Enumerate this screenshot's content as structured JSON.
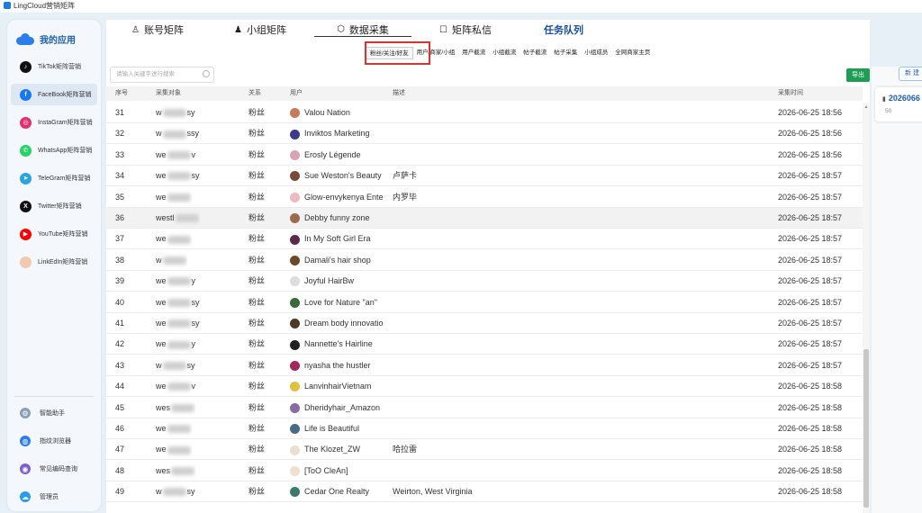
{
  "window": {
    "title": "LingCloud营销矩阵"
  },
  "sidebar": {
    "header": "我的应用",
    "items": [
      {
        "label": "TikTok矩阵营销",
        "icon": "tiktok-icon",
        "color": "#111111",
        "glyph": "♪",
        "active": false
      },
      {
        "label": "FaceBook矩阵营销",
        "icon": "facebook-icon",
        "color": "#1877f2",
        "glyph": "f",
        "active": true
      },
      {
        "label": "InstaGram矩阵营销",
        "icon": "instagram-icon",
        "color": "#e1306c",
        "glyph": "◎",
        "active": false
      },
      {
        "label": "WhatsApp矩阵营销",
        "icon": "whatsapp-icon",
        "color": "#25d366",
        "glyph": "✆",
        "active": false
      },
      {
        "label": "TeleGram矩阵营销",
        "icon": "telegram-icon",
        "color": "#2aa3df",
        "glyph": "➤",
        "active": false
      },
      {
        "label": "Twitter矩阵营销",
        "icon": "twitter-x-icon",
        "color": "#111111",
        "glyph": "X",
        "active": false
      },
      {
        "label": "YouTube矩阵营销",
        "icon": "youtube-icon",
        "color": "#ff0000",
        "glyph": "▶",
        "active": false
      },
      {
        "label": "LinkEdIn矩阵营销",
        "icon": "linkedin-icon",
        "color": "#f0c9b0",
        "glyph": "",
        "active": false
      }
    ],
    "tools": [
      {
        "label": "智能助手",
        "icon": "gear-icon",
        "color": "#8aa0b8",
        "glyph": "⚙"
      },
      {
        "label": "指纹浏览器",
        "icon": "globe-icon",
        "color": "#2b7de9",
        "glyph": "◍"
      },
      {
        "label": "常见编码查询",
        "icon": "code-query-icon",
        "color": "#7b5fd1",
        "glyph": "◉"
      },
      {
        "label": "管理员",
        "icon": "admin-cloud-icon",
        "color": "#2b9be9",
        "glyph": "☁"
      }
    ]
  },
  "tabs": [
    {
      "label": "账号矩阵",
      "icon": "person-icon",
      "glyph": "♙",
      "active": false,
      "bold": false
    },
    {
      "label": "小组矩阵",
      "icon": "group-icon",
      "glyph": "♟",
      "active": false,
      "bold": false
    },
    {
      "label": "数据采集",
      "icon": "cube-icon",
      "glyph": "⬡",
      "active": true,
      "bold": false
    },
    {
      "label": "矩阵私信",
      "icon": "message-icon",
      "glyph": "☐",
      "active": false,
      "bold": false
    },
    {
      "label": "任务队列",
      "icon": "",
      "glyph": "",
      "active": false,
      "bold": true
    }
  ],
  "subtabs": [
    {
      "label": "粉丝/关注/好友",
      "active": true
    },
    {
      "label": "用户/商家/小组",
      "active": false
    },
    {
      "label": "用户截流",
      "active": false
    },
    {
      "label": "小组截流",
      "active": false
    },
    {
      "label": "帖子截流",
      "active": false
    },
    {
      "label": "帖子采集",
      "active": false
    },
    {
      "label": "小组成员",
      "active": false
    },
    {
      "label": "全网商家主页",
      "active": false
    }
  ],
  "search": {
    "placeholder": "请输入关键字进行搜索"
  },
  "toolbar": {
    "export_label": "导出"
  },
  "table": {
    "columns": {
      "no": "序号",
      "target": "采集对象",
      "relation": "关系",
      "user": "用户",
      "desc": "描述",
      "time": "采集时间"
    },
    "rows": [
      {
        "no": "31",
        "t1": "w",
        "t2": "sy",
        "rel": "粉丝",
        "user": "Valou Nation",
        "desc": "",
        "time": "2026-06-25 18:56",
        "av": "#c67b5c"
      },
      {
        "no": "32",
        "t1": "w",
        "t2": "ssy",
        "rel": "粉丝",
        "user": "Inviktos Marketing",
        "desc": "",
        "time": "2026-06-25 18:56",
        "av": "#3b3b8c"
      },
      {
        "no": "33",
        "t1": "we",
        "t2": "v",
        "rel": "粉丝",
        "user": "Erosly Légende",
        "desc": "",
        "time": "2026-06-25 18:56",
        "av": "#d9a3b5"
      },
      {
        "no": "34",
        "t1": "we",
        "t2": "sy",
        "rel": "粉丝",
        "user": "Sue Weston's Beauty",
        "desc": "卢萨卡",
        "time": "2026-06-25 18:57",
        "av": "#7a4a3a"
      },
      {
        "no": "35",
        "t1": "we",
        "t2": "",
        "rel": "粉丝",
        "user": "Glow-envykenya Enterprises",
        "desc": "内罗毕",
        "time": "2026-06-25 18:57",
        "av": "#f0b8c0"
      },
      {
        "no": "36",
        "t1": "westl",
        "t2": "",
        "rel": "粉丝",
        "user": "Debby funny zone",
        "desc": "",
        "time": "2026-06-25 18:57",
        "av": "#9c6b4e"
      },
      {
        "no": "37",
        "t1": "we",
        "t2": "",
        "rel": "粉丝",
        "user": "In My Soft Girl Era",
        "desc": "",
        "time": "2026-06-25 18:57",
        "av": "#5a2a4a"
      },
      {
        "no": "38",
        "t1": "w",
        "t2": "",
        "rel": "粉丝",
        "user": "Damali's hair shop",
        "desc": "",
        "time": "2026-06-25 18:57",
        "av": "#6b4a2a"
      },
      {
        "no": "39",
        "t1": "we",
        "t2": "y",
        "rel": "粉丝",
        "user": "Joyful HairBw",
        "desc": "",
        "time": "2026-06-25 18:57",
        "av": "#dddddd"
      },
      {
        "no": "40",
        "t1": "we",
        "t2": "sy",
        "rel": "粉丝",
        "user": "Love for Nature \"an\"",
        "desc": "",
        "time": "2026-06-25 18:57",
        "av": "#3a6a3a"
      },
      {
        "no": "41",
        "t1": "we",
        "t2": "sy",
        "rel": "粉丝",
        "user": "Dream body innovations",
        "desc": "",
        "time": "2026-06-25 18:57",
        "av": "#4a3a2a"
      },
      {
        "no": "42",
        "t1": "we",
        "t2": "y",
        "rel": "粉丝",
        "user": "Nannette's Hairline",
        "desc": "",
        "time": "2026-06-25 18:57",
        "av": "#222222"
      },
      {
        "no": "43",
        "t1": "w",
        "t2": "sy",
        "rel": "粉丝",
        "user": "nyasha the hustler",
        "desc": "",
        "time": "2026-06-25 18:57",
        "av": "#a02a5a"
      },
      {
        "no": "44",
        "t1": "we",
        "t2": "v",
        "rel": "粉丝",
        "user": "LanvinhairVietnam",
        "desc": "",
        "time": "2026-06-25 18:58",
        "av": "#e0c040"
      },
      {
        "no": "45",
        "t1": "wes",
        "t2": "",
        "rel": "粉丝",
        "user": "Dheridyhair_Amazon",
        "desc": "",
        "time": "2026-06-25 18:58",
        "av": "#8a6aa0"
      },
      {
        "no": "46",
        "t1": "we",
        "t2": "",
        "rel": "粉丝",
        "user": "Life is Beautiful",
        "desc": "",
        "time": "2026-06-25 18:58",
        "av": "#4a6a8a"
      },
      {
        "no": "47",
        "t1": "we",
        "t2": "",
        "rel": "粉丝",
        "user": "The Klozet_ZW",
        "desc": "哈拉雷",
        "time": "2026-06-25 18:58",
        "av": "#e8e0d0"
      },
      {
        "no": "48",
        "t1": "wes",
        "t2": "",
        "rel": "粉丝",
        "user": "[ToO CleAn]",
        "desc": "",
        "time": "2026-06-25 18:58",
        "av": "#f0e0d0"
      },
      {
        "no": "49",
        "t1": "w",
        "t2": "sy",
        "rel": "粉丝",
        "user": "Cedar One Realty",
        "desc": "Weirton, West Virginia",
        "time": "2026-06-25 18:58",
        "av": "#3a7a6a"
      }
    ]
  },
  "right_panel": {
    "button_label": "新 建",
    "card_date": "2026066",
    "card_count": "50"
  }
}
